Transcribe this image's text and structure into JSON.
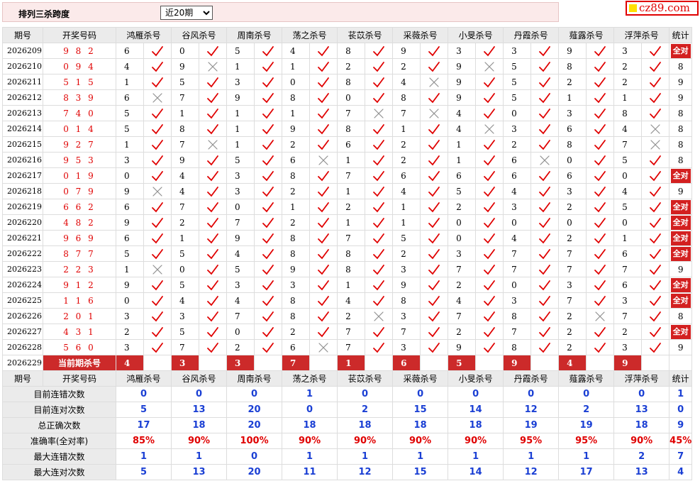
{
  "header": {
    "title": "排列三杀跨度",
    "period_selected": "近20期",
    "period_options": [
      "近20期"
    ]
  },
  "logo": {
    "text": "cz89.com",
    "colors": {
      "square": "#ffe000",
      "text": "#e00000"
    }
  },
  "table": {
    "columns": [
      "期号",
      "开奖号码",
      "鸿雁杀号",
      "谷风杀号",
      "周南杀号",
      "荡之杀号",
      "苌苡杀号",
      "采薇杀号",
      "小旻杀号",
      "丹霞杀号",
      "薤露杀号",
      "浮萍杀号",
      "统计"
    ],
    "rows": [
      {
        "issue": "2026209",
        "draw": "982",
        "kills": [
          [
            "6",
            1
          ],
          [
            "0",
            1
          ],
          [
            "5",
            1
          ],
          [
            "4",
            1
          ],
          [
            "8",
            1
          ],
          [
            "9",
            1
          ],
          [
            "3",
            1
          ],
          [
            "3",
            1
          ],
          [
            "9",
            1
          ],
          [
            "3",
            1
          ]
        ],
        "stat": "全对"
      },
      {
        "issue": "2026210",
        "draw": "094",
        "kills": [
          [
            "4",
            1
          ],
          [
            "9",
            0
          ],
          [
            "1",
            1
          ],
          [
            "1",
            1
          ],
          [
            "2",
            1
          ],
          [
            "2",
            1
          ],
          [
            "9",
            0
          ],
          [
            "5",
            1
          ],
          [
            "8",
            1
          ],
          [
            "2",
            1
          ]
        ],
        "stat": "8"
      },
      {
        "issue": "2026211",
        "draw": "515",
        "kills": [
          [
            "1",
            1
          ],
          [
            "5",
            1
          ],
          [
            "3",
            1
          ],
          [
            "0",
            1
          ],
          [
            "8",
            1
          ],
          [
            "4",
            0
          ],
          [
            "9",
            1
          ],
          [
            "5",
            1
          ],
          [
            "2",
            1
          ],
          [
            "2",
            1
          ]
        ],
        "stat": "9"
      },
      {
        "issue": "2026212",
        "draw": "839",
        "kills": [
          [
            "6",
            0
          ],
          [
            "7",
            1
          ],
          [
            "9",
            1
          ],
          [
            "8",
            1
          ],
          [
            "0",
            1
          ],
          [
            "8",
            1
          ],
          [
            "9",
            1
          ],
          [
            "5",
            1
          ],
          [
            "1",
            1
          ],
          [
            "1",
            1
          ]
        ],
        "stat": "9"
      },
      {
        "issue": "2026213",
        "draw": "740",
        "kills": [
          [
            "5",
            1
          ],
          [
            "1",
            1
          ],
          [
            "1",
            1
          ],
          [
            "1",
            1
          ],
          [
            "7",
            0
          ],
          [
            "7",
            0
          ],
          [
            "4",
            1
          ],
          [
            "0",
            1
          ],
          [
            "3",
            1
          ],
          [
            "8",
            1
          ]
        ],
        "stat": "8"
      },
      {
        "issue": "2026214",
        "draw": "014",
        "kills": [
          [
            "5",
            1
          ],
          [
            "8",
            1
          ],
          [
            "1",
            1
          ],
          [
            "9",
            1
          ],
          [
            "8",
            1
          ],
          [
            "1",
            1
          ],
          [
            "4",
            0
          ],
          [
            "3",
            1
          ],
          [
            "6",
            1
          ],
          [
            "4",
            0
          ]
        ],
        "stat": "8"
      },
      {
        "issue": "2026215",
        "draw": "927",
        "kills": [
          [
            "1",
            1
          ],
          [
            "7",
            0
          ],
          [
            "1",
            1
          ],
          [
            "2",
            1
          ],
          [
            "6",
            1
          ],
          [
            "2",
            1
          ],
          [
            "1",
            1
          ],
          [
            "2",
            1
          ],
          [
            "8",
            1
          ],
          [
            "7",
            0
          ]
        ],
        "stat": "8"
      },
      {
        "issue": "2026216",
        "draw": "953",
        "kills": [
          [
            "3",
            1
          ],
          [
            "9",
            1
          ],
          [
            "5",
            1
          ],
          [
            "6",
            0
          ],
          [
            "1",
            1
          ],
          [
            "2",
            1
          ],
          [
            "1",
            1
          ],
          [
            "6",
            0
          ],
          [
            "0",
            1
          ],
          [
            "5",
            1
          ]
        ],
        "stat": "8"
      },
      {
        "issue": "2026217",
        "draw": "019",
        "kills": [
          [
            "0",
            1
          ],
          [
            "4",
            1
          ],
          [
            "3",
            1
          ],
          [
            "8",
            1
          ],
          [
            "7",
            1
          ],
          [
            "6",
            1
          ],
          [
            "6",
            1
          ],
          [
            "6",
            1
          ],
          [
            "6",
            1
          ],
          [
            "0",
            1
          ]
        ],
        "stat": "全对"
      },
      {
        "issue": "2026218",
        "draw": "079",
        "kills": [
          [
            "9",
            0
          ],
          [
            "4",
            1
          ],
          [
            "3",
            1
          ],
          [
            "2",
            1
          ],
          [
            "1",
            1
          ],
          [
            "4",
            1
          ],
          [
            "5",
            1
          ],
          [
            "4",
            1
          ],
          [
            "3",
            1
          ],
          [
            "4",
            1
          ]
        ],
        "stat": "9"
      },
      {
        "issue": "2026219",
        "draw": "662",
        "kills": [
          [
            "6",
            1
          ],
          [
            "7",
            1
          ],
          [
            "0",
            1
          ],
          [
            "1",
            1
          ],
          [
            "2",
            1
          ],
          [
            "1",
            1
          ],
          [
            "2",
            1
          ],
          [
            "3",
            1
          ],
          [
            "2",
            1
          ],
          [
            "5",
            1
          ]
        ],
        "stat": "全对"
      },
      {
        "issue": "2026220",
        "draw": "482",
        "kills": [
          [
            "9",
            1
          ],
          [
            "2",
            1
          ],
          [
            "7",
            1
          ],
          [
            "2",
            1
          ],
          [
            "1",
            1
          ],
          [
            "1",
            1
          ],
          [
            "0",
            1
          ],
          [
            "0",
            1
          ],
          [
            "0",
            1
          ],
          [
            "0",
            1
          ]
        ],
        "stat": "全对"
      },
      {
        "issue": "2026221",
        "draw": "969",
        "kills": [
          [
            "6",
            1
          ],
          [
            "1",
            1
          ],
          [
            "9",
            1
          ],
          [
            "8",
            1
          ],
          [
            "7",
            1
          ],
          [
            "5",
            1
          ],
          [
            "0",
            1
          ],
          [
            "4",
            1
          ],
          [
            "2",
            1
          ],
          [
            "1",
            1
          ]
        ],
        "stat": "全对"
      },
      {
        "issue": "2026222",
        "draw": "877",
        "kills": [
          [
            "5",
            1
          ],
          [
            "5",
            1
          ],
          [
            "4",
            1
          ],
          [
            "8",
            1
          ],
          [
            "8",
            1
          ],
          [
            "2",
            1
          ],
          [
            "3",
            1
          ],
          [
            "7",
            1
          ],
          [
            "7",
            1
          ],
          [
            "6",
            1
          ]
        ],
        "stat": "全对"
      },
      {
        "issue": "2026223",
        "draw": "223",
        "kills": [
          [
            "1",
            0
          ],
          [
            "0",
            1
          ],
          [
            "5",
            1
          ],
          [
            "9",
            1
          ],
          [
            "8",
            1
          ],
          [
            "3",
            1
          ],
          [
            "7",
            1
          ],
          [
            "7",
            1
          ],
          [
            "7",
            1
          ],
          [
            "7",
            1
          ]
        ],
        "stat": "9"
      },
      {
        "issue": "2026224",
        "draw": "912",
        "kills": [
          [
            "9",
            1
          ],
          [
            "5",
            1
          ],
          [
            "3",
            1
          ],
          [
            "3",
            1
          ],
          [
            "1",
            1
          ],
          [
            "9",
            1
          ],
          [
            "2",
            1
          ],
          [
            "0",
            1
          ],
          [
            "3",
            1
          ],
          [
            "6",
            1
          ]
        ],
        "stat": "全对"
      },
      {
        "issue": "2026225",
        "draw": "116",
        "kills": [
          [
            "0",
            1
          ],
          [
            "4",
            1
          ],
          [
            "4",
            1
          ],
          [
            "8",
            1
          ],
          [
            "4",
            1
          ],
          [
            "8",
            1
          ],
          [
            "4",
            1
          ],
          [
            "3",
            1
          ],
          [
            "7",
            1
          ],
          [
            "3",
            1
          ]
        ],
        "stat": "全对"
      },
      {
        "issue": "2026226",
        "draw": "201",
        "kills": [
          [
            "3",
            1
          ],
          [
            "3",
            1
          ],
          [
            "7",
            1
          ],
          [
            "8",
            1
          ],
          [
            "2",
            0
          ],
          [
            "3",
            1
          ],
          [
            "7",
            1
          ],
          [
            "8",
            1
          ],
          [
            "2",
            0
          ],
          [
            "7",
            1
          ]
        ],
        "stat": "8"
      },
      {
        "issue": "2026227",
        "draw": "431",
        "kills": [
          [
            "2",
            1
          ],
          [
            "5",
            1
          ],
          [
            "0",
            1
          ],
          [
            "2",
            1
          ],
          [
            "7",
            1
          ],
          [
            "7",
            1
          ],
          [
            "2",
            1
          ],
          [
            "7",
            1
          ],
          [
            "2",
            1
          ],
          [
            "2",
            1
          ]
        ],
        "stat": "全对"
      },
      {
        "issue": "2026228",
        "draw": "560",
        "kills": [
          [
            "3",
            1
          ],
          [
            "7",
            1
          ],
          [
            "2",
            1
          ],
          [
            "6",
            0
          ],
          [
            "7",
            1
          ],
          [
            "3",
            1
          ],
          [
            "9",
            1
          ],
          [
            "8",
            1
          ],
          [
            "2",
            1
          ],
          [
            "3",
            1
          ]
        ],
        "stat": "9"
      }
    ],
    "current": {
      "issue": "2026229",
      "label": "当前期杀号",
      "values": [
        "4",
        "3",
        "3",
        "7",
        "1",
        "6",
        "5",
        "9",
        "4",
        "9"
      ]
    },
    "stats": [
      {
        "label": "目前连错次数",
        "values": [
          "0",
          "0",
          "0",
          "1",
          "0",
          "0",
          "0",
          "0",
          "0",
          "0",
          "1"
        ],
        "red": false
      },
      {
        "label": "目前连对次数",
        "values": [
          "5",
          "13",
          "20",
          "0",
          "2",
          "15",
          "14",
          "12",
          "2",
          "13",
          "0"
        ],
        "red": false
      },
      {
        "label": "总正确次数",
        "values": [
          "17",
          "18",
          "20",
          "18",
          "18",
          "18",
          "18",
          "19",
          "19",
          "18",
          "9"
        ],
        "red": false
      },
      {
        "label": "准确率(全对率)",
        "values": [
          "85%",
          "90%",
          "100%",
          "90%",
          "90%",
          "90%",
          "90%",
          "95%",
          "95%",
          "90%",
          "45%"
        ],
        "red": true
      },
      {
        "label": "最大连错次数",
        "values": [
          "1",
          "1",
          "0",
          "1",
          "1",
          "1",
          "1",
          "1",
          "1",
          "2",
          "7"
        ],
        "red": false
      },
      {
        "label": "最大连对次数",
        "values": [
          "5",
          "13",
          "20",
          "11",
          "12",
          "15",
          "14",
          "12",
          "17",
          "13",
          "4"
        ],
        "red": false
      }
    ]
  },
  "colors": {
    "check": "#e00000",
    "cross": "#909090",
    "current_bg": "#cc2a2a",
    "stat_blue": "#1a3fd4",
    "header_bg": "#ebebeb"
  }
}
